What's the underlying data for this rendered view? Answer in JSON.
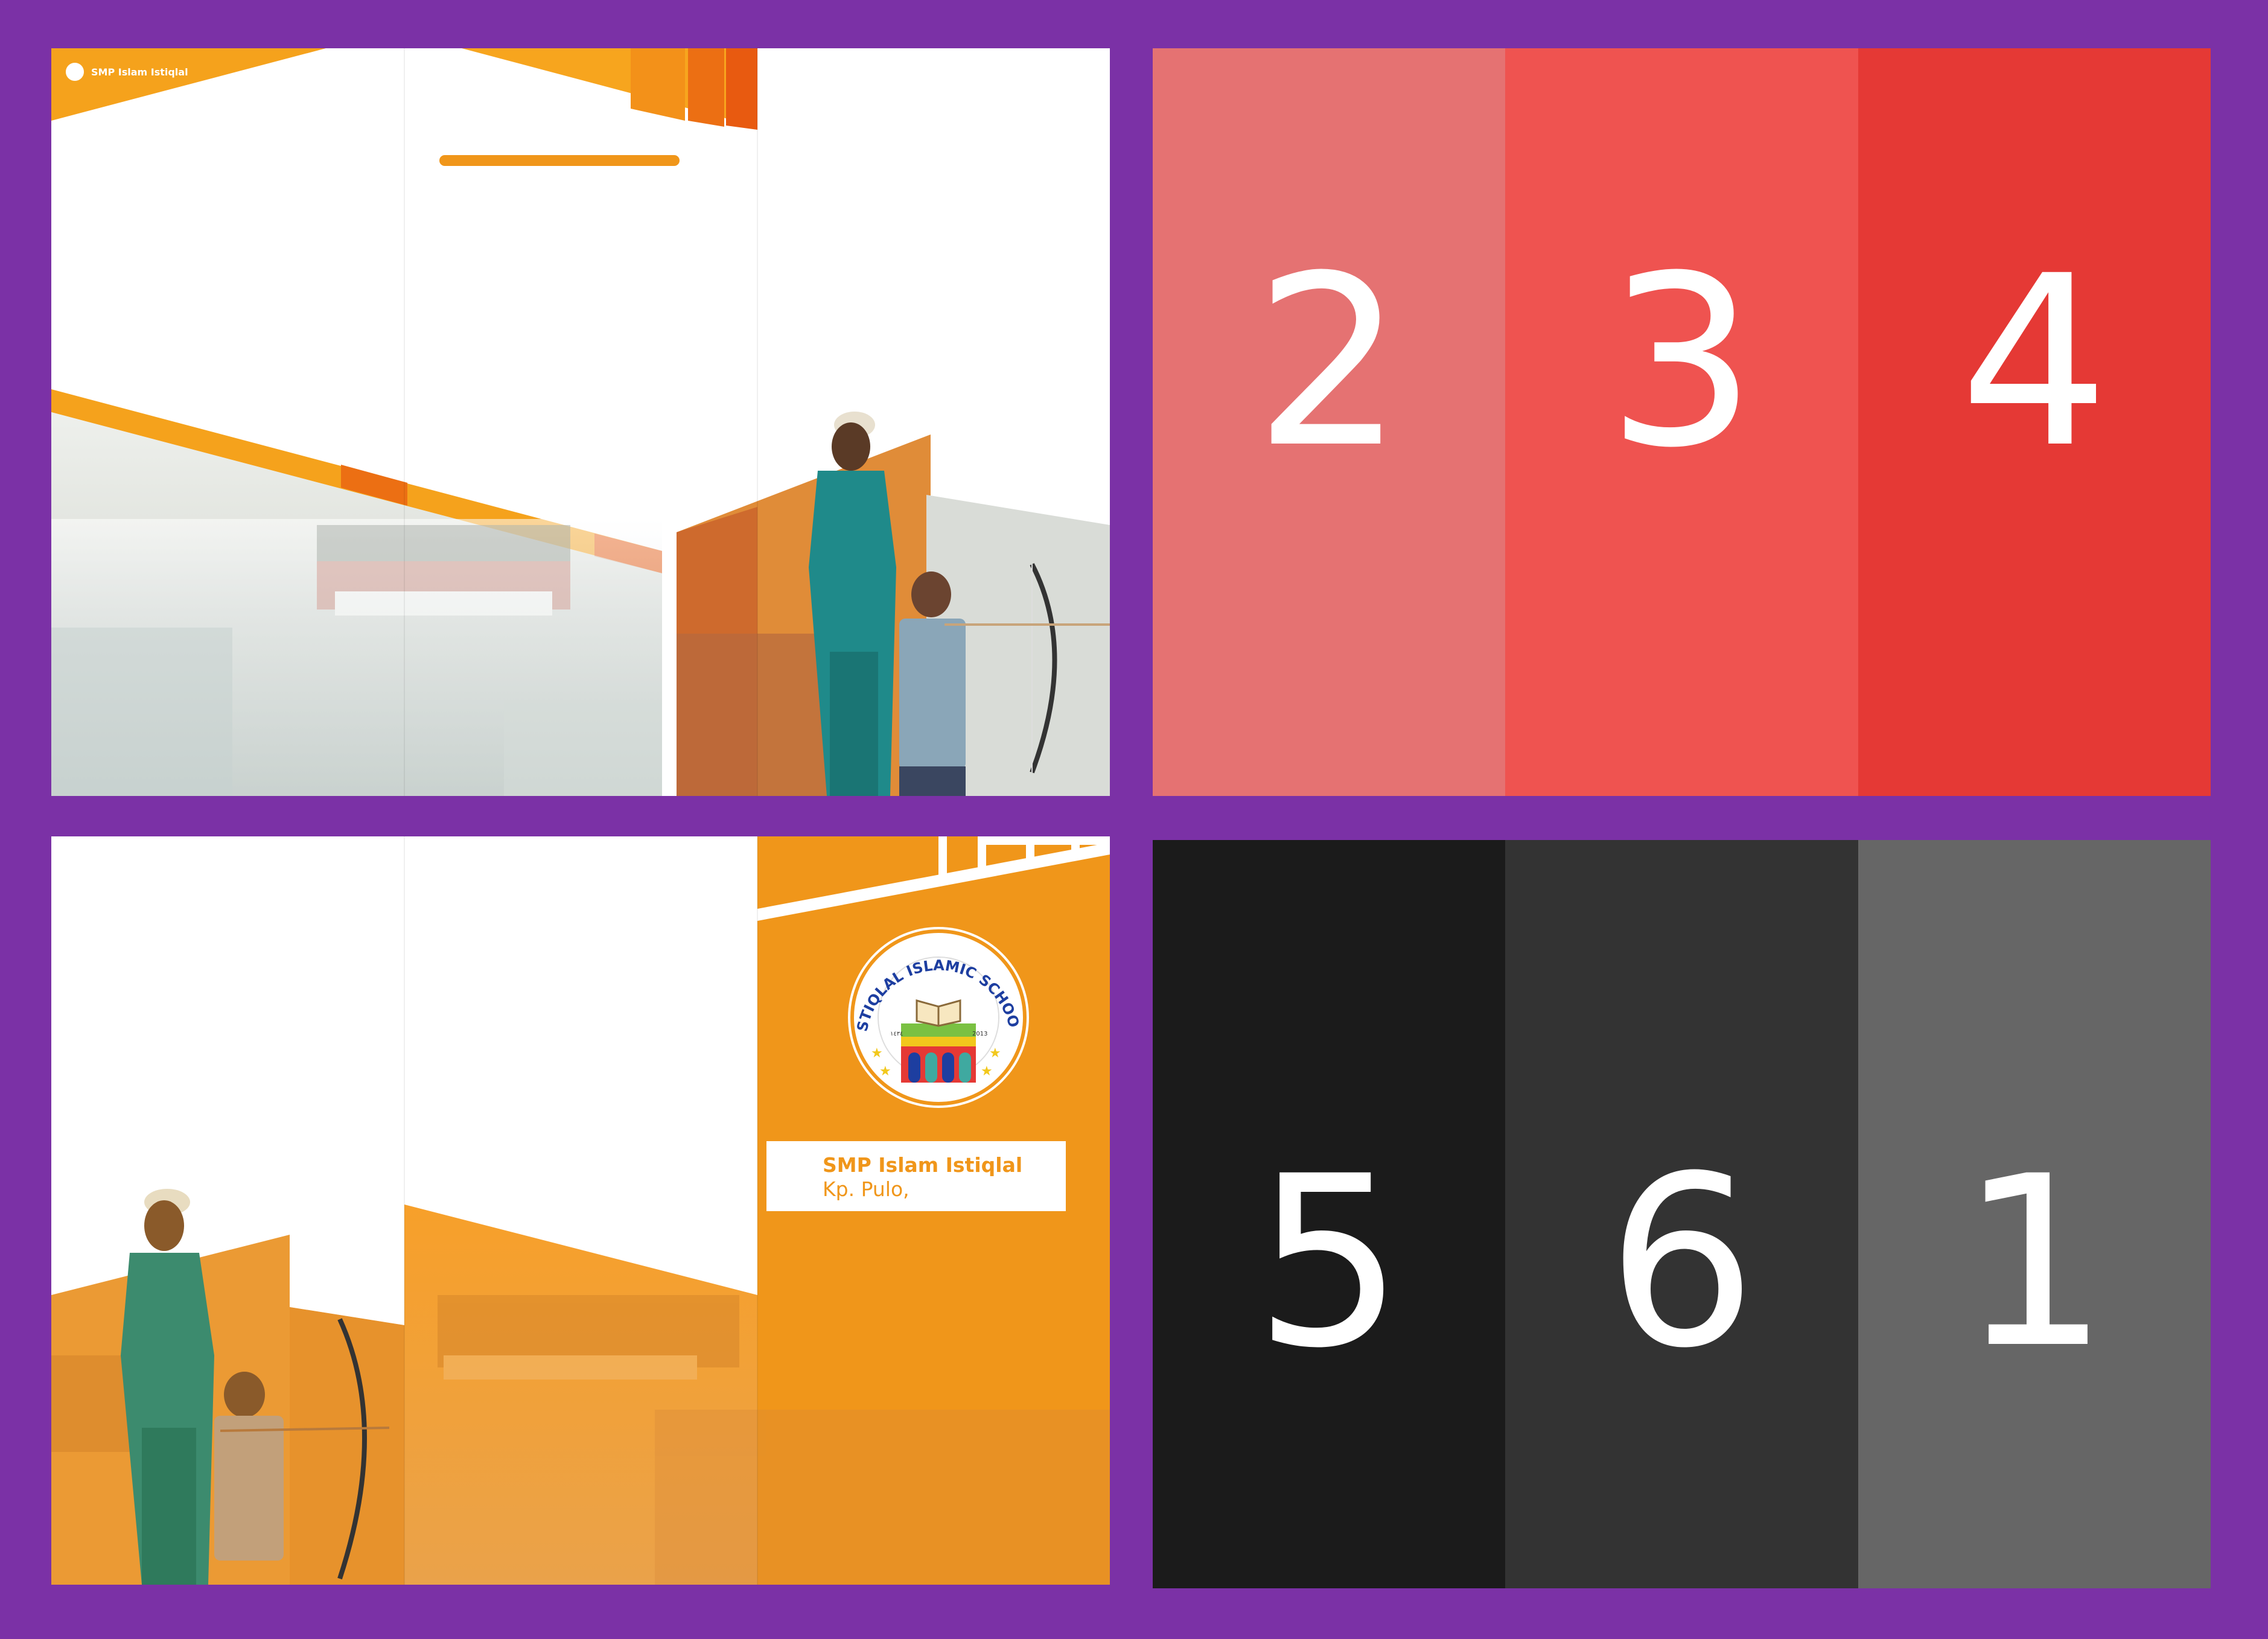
{
  "cover_outside": {
    "brand_name": "SMP Islam Istiqlal"
  },
  "cover_inside": {
    "emblem_ring_text": "ISTIQLAL ISLAMIC SCHOOL",
    "emblem_year": "2013",
    "emblem_arabic": "١٤٣٤",
    "school_name": "SMP Islam Istiqlal",
    "school_address": "Kp. Pulo,"
  },
  "panel_numbers_top": [
    "2",
    "3",
    "4"
  ],
  "panel_numbers_bottom": [
    "5",
    "6",
    "1"
  ],
  "colors": {
    "background": "#7b31a6",
    "orange": "#f0961a",
    "top_panels": [
      "#e57272",
      "#ef5350",
      "#e53935"
    ],
    "bottom_panels": [
      "#1b1b1b",
      "#333333",
      "#666666"
    ]
  },
  "icons": [
    "school-logo-icon",
    "school-emblem-icon",
    "teacher-photo",
    "archery-student-photo",
    "assembly-photo"
  ]
}
